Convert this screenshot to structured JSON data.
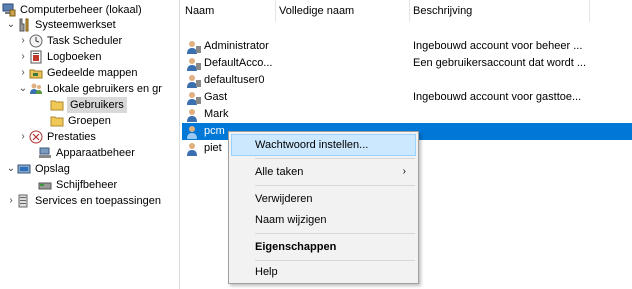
{
  "tree": {
    "root": "Computerbeheer (lokaal)",
    "systeemwerkset": "Systeemwerkset",
    "task_scheduler": "Task Scheduler",
    "logboeken": "Logboeken",
    "gedeelde_mappen": "Gedeelde mappen",
    "lokale_gebruikers": "Lokale gebruikers en gr",
    "gebruikers": "Gebruikers",
    "groepen": "Groepen",
    "prestaties": "Prestaties",
    "apparaatbeheer": "Apparaatbeheer",
    "opslag": "Opslag",
    "schijfbeheer": "Schijfbeheer",
    "services": "Services en toepassingen"
  },
  "list": {
    "columns": [
      "Naam",
      "Volledige naam",
      "Beschrijving"
    ],
    "rows": [
      {
        "name": "Administrator",
        "fullname": "",
        "desc": "Ingebouwd account voor beheer ..."
      },
      {
        "name": "DefaultAcco...",
        "fullname": "",
        "desc": "Een gebruikersaccount dat wordt ..."
      },
      {
        "name": "defaultuser0",
        "fullname": "",
        "desc": ""
      },
      {
        "name": "Gast",
        "fullname": "",
        "desc": "Ingebouwd account voor gasttoe..."
      },
      {
        "name": "Mark",
        "fullname": "",
        "desc": ""
      },
      {
        "name": "pcm",
        "fullname": "",
        "desc": ""
      },
      {
        "name": "piet",
        "fullname": "",
        "desc": ""
      }
    ],
    "selected_row": "pcm"
  },
  "context_menu": {
    "set_password": "Wachtwoord instellen...",
    "all_tasks": "Alle taken",
    "delete": "Verwijderen",
    "rename": "Naam wijzigen",
    "properties": "Eigenschappen",
    "help": "Help"
  },
  "colors": {
    "selection": "#0078d7",
    "menu_hover": "#cce8ff",
    "menu_bg": "#f2f2f2"
  }
}
